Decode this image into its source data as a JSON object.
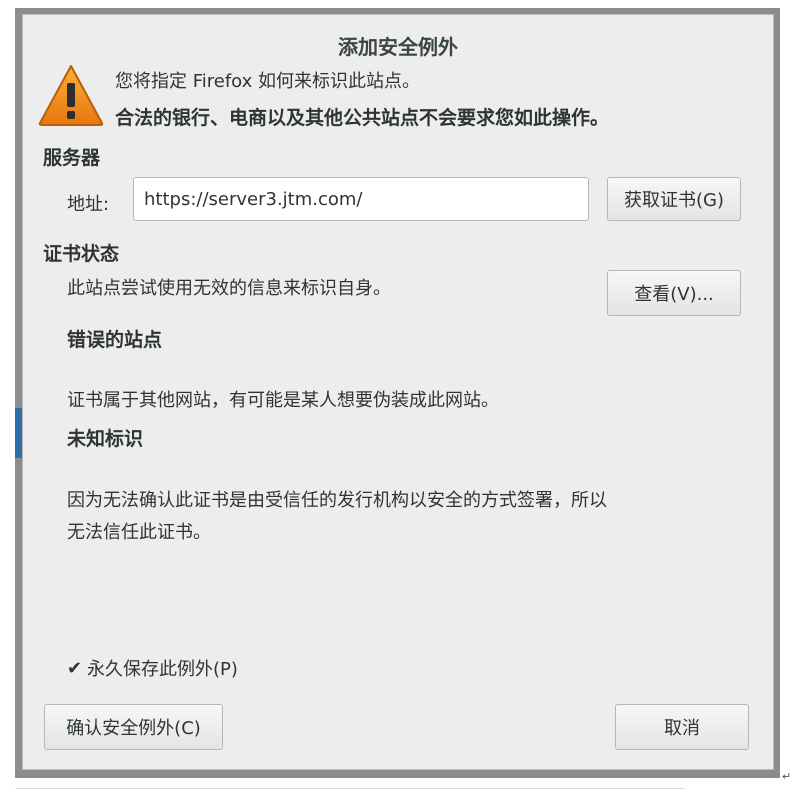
{
  "dialog": {
    "title": "添加安全例外",
    "intro_line1": "您将指定 Firefox 如何来标识此站点。",
    "intro_line2": "合法的银行、电商以及其他公共站点不会要求您如此操作。"
  },
  "server": {
    "heading": "服务器",
    "address_label": "地址:",
    "address_value": "https://server3.jtm.com/",
    "get_cert_label": "获取证书(G)"
  },
  "cert_status": {
    "heading": "证书状态",
    "summary": "此站点尝试使用无效的信息来标识自身。",
    "view_label": "查看(V)...",
    "wrong_site_heading": "错误的站点",
    "wrong_site_text": "证书属于其他网站，有可能是某人想要伪装成此网站。",
    "unknown_identity_heading": "未知标识",
    "unknown_identity_text_line1": "因为无法确认此证书是由受信任的发行机构以安全的方式签署，所以",
    "unknown_identity_text_line2": "无法信任此证书。"
  },
  "options": {
    "permanent_label": "永久保存此例外(P)",
    "permanent_checked": true
  },
  "footer": {
    "confirm_label": "确认安全例外(C)",
    "cancel_label": "取消"
  },
  "icons": {
    "warning": "warning-triangle-icon",
    "checkbox": "checkmark-icon"
  },
  "colors": {
    "warning_fill": "#f08b1d",
    "dialog_bg": "#ededed"
  }
}
